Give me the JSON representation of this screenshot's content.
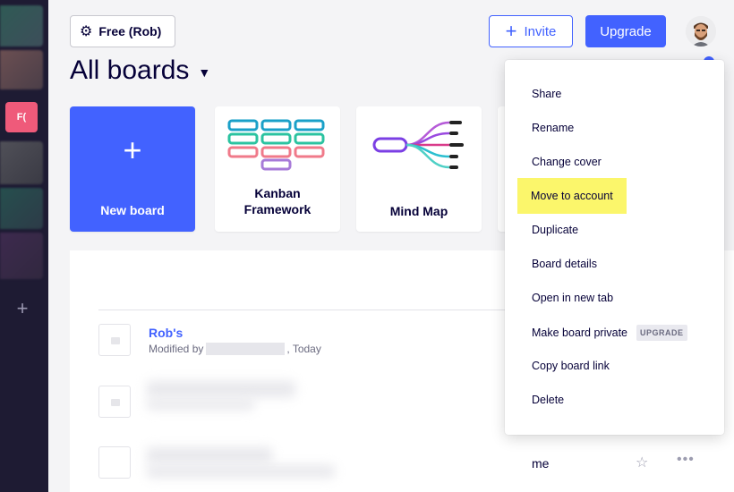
{
  "sidebar": {
    "active_workspace_initials": "F(",
    "add_icon": "plus-icon"
  },
  "header": {
    "plan_label": "Free (Rob)",
    "plan_icon": "gear-icon",
    "invite_label": "Invite",
    "upgrade_label": "Upgrade",
    "page_title": "All boards"
  },
  "templates": {
    "new_board_label": "New board",
    "items": [
      {
        "label_line1": "Kanban",
        "label_line2": "Framework"
      },
      {
        "label": "Mind Map"
      }
    ]
  },
  "boards": [
    {
      "name": "Rob's",
      "modified_prefix": "Modified by",
      "modified_suffix": ", Today"
    }
  ],
  "row3": {
    "owner": "me"
  },
  "context_menu": {
    "items": [
      {
        "label": "Share"
      },
      {
        "label": "Rename"
      },
      {
        "label": "Change cover"
      },
      {
        "label": "Move to account",
        "highlighted": true
      },
      {
        "label": "Duplicate"
      },
      {
        "label": "Board details"
      },
      {
        "label": "Open in new tab"
      },
      {
        "label": "Make board private",
        "badge": "UPGRADE"
      },
      {
        "label": "Copy board link"
      },
      {
        "label": "Delete"
      }
    ]
  },
  "colors": {
    "accent": "#4262ff",
    "rail": "#1e1b33",
    "highlight": "#fbf66b",
    "workspace_active": "#ef5a7a"
  }
}
